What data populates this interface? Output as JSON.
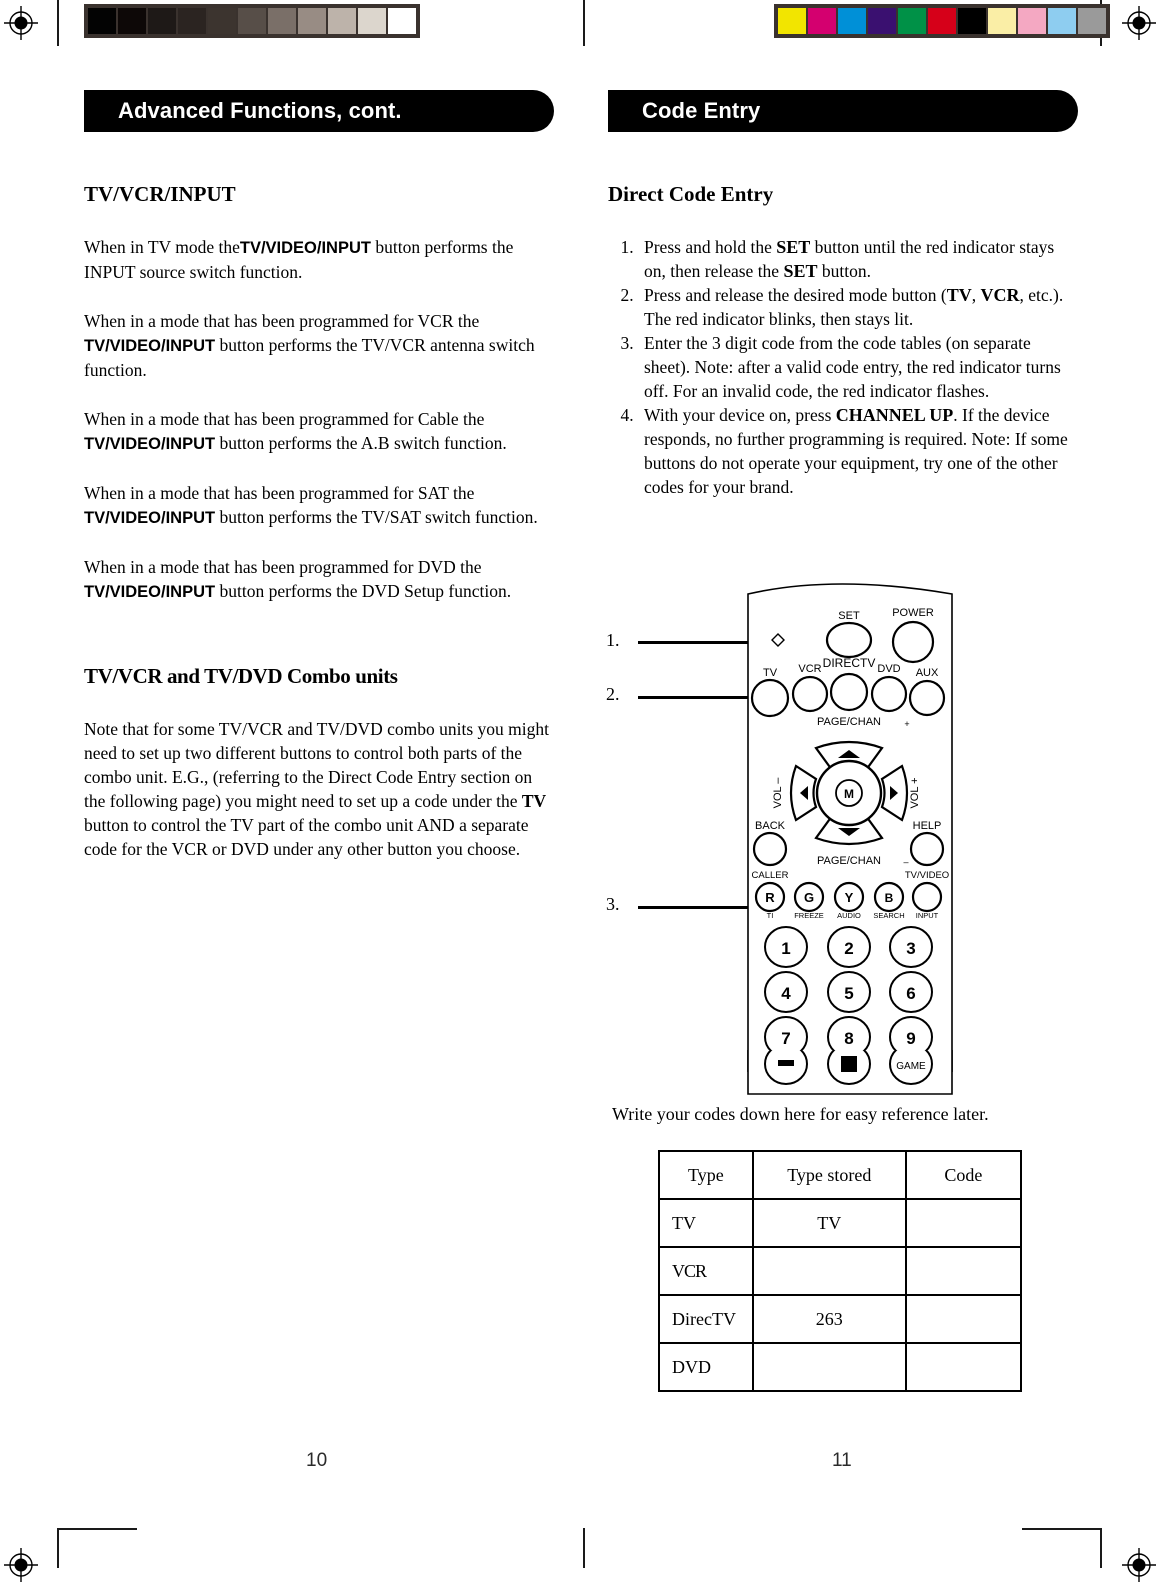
{
  "calibration": {
    "gray_patches": [
      "#030303",
      "#0d0807",
      "#1e1917",
      "#2b2421",
      "#3c342f",
      "#574e48",
      "#7a6f68",
      "#988c84",
      "#bdb3aa",
      "#dcd6cd",
      "#ffffff"
    ],
    "color_patches": [
      "#f2e500",
      "#d4006f",
      "#0090d7",
      "#3a1070",
      "#009147",
      "#d60019",
      "#000000",
      "#faeea6",
      "#f4a8c2",
      "#8ecdf0",
      "#9a9a9a"
    ]
  },
  "left_page": {
    "banner": "Advanced Functions, cont.",
    "heading1": "TV/VCR/INPUT",
    "paragraphs": [
      {
        "pre": "When in TV mode the",
        "bold": "TV/VIDEO/INPUT",
        "post": "button performs the  INPUT source switch function."
      },
      {
        "pre": "When in a mode that has been programmed for VCR the",
        "bold": "TV/VIDEO/INPUT",
        "post": "button performs the TV/VCR antenna switch function."
      },
      {
        "pre": "When in a mode that has been programmed for Cable the",
        "bold": "TV/VIDEO/INPUT",
        "post": "button performs the A.B switch function."
      },
      {
        "pre": "When in a mode that has been programmed for SAT the",
        "bold": "TV/VIDEO/INPUT",
        "post": "button performs the TV/SAT switch function."
      },
      {
        "pre": "When in a mode that has been programmed for DVD the",
        "bold": "TV/VIDEO/INPUT",
        "post": "button performs the DVD Setup function."
      }
    ],
    "heading2": "TV/VCR and TV/DVD Combo units",
    "combo_paragraph_part1": "Note that for some TV/VCR and TV/DVD combo units you might need to set up two different buttons to control both parts of the combo unit. E.G., (referring to the  Direct Code Entry section on the following page) you might need to set up a code under the",
    "combo_paragraph_bold": "TV",
    "combo_paragraph_part2": "button to control the TV part of the combo unit AND a separate code for the VCR or DVD under any other button you choose.",
    "page_number": "10"
  },
  "right_page": {
    "banner": "Code Entry",
    "heading1": "Direct Code Entry",
    "steps": [
      {
        "num": "1.",
        "seg1": "Press and hold the ",
        "sc1": "SET",
        "seg2": " button until the red indicator stays on, then release the ",
        "sc2": "SET",
        "seg3": " button."
      },
      {
        "num": "2.",
        "seg1": "Press and release the desired mode button (",
        "b1": "TV",
        "seg2": ", ",
        "b2": "VCR",
        "seg3": ", etc.). The red indicator blinks, then stays lit."
      },
      {
        "num": "3.",
        "seg1": "Enter the 3 digit code from the code tables (on separate sheet). Note: after a valid code entry, the red indicator turns off.  For an invalid code, the red indicator flashes."
      },
      {
        "num": "4.",
        "seg1": "With your device on, press ",
        "sc1": "CHANNEL UP",
        "seg2": ". If the device responds, no further programming is required. Note: If some buttons do not operate your equipment, try one of the other codes for your brand."
      }
    ],
    "table_caption": "Write your codes down here for easy reference later.",
    "table": {
      "headers": [
        "Type",
        "Type  stored",
        "Code"
      ],
      "rows": [
        {
          "type": "TV",
          "stored": "TV",
          "code": ""
        },
        {
          "type": "VCR",
          "stored": "",
          "code": ""
        },
        {
          "type": "DirecTV",
          "stored": "263",
          "code": ""
        },
        {
          "type": "DVD",
          "stored": "",
          "code": ""
        }
      ]
    },
    "page_number": "11"
  },
  "remote": {
    "callouts": [
      {
        "label": "1.",
        "target": "set-button"
      },
      {
        "label": "2.",
        "target": "tv-mode-button"
      },
      {
        "label": "3.",
        "target": "keypad-one-button"
      }
    ],
    "labels": {
      "set": "SET",
      "power": "POWER",
      "tv": "TV",
      "vcr": "VCR",
      "directv": "DIRECTV",
      "dvd": "DVD",
      "aux": "AUX",
      "page_chan_up": "PAGE/CHAN",
      "page_chan_up_sign": "+",
      "page_chan_down": "PAGE/CHAN",
      "page_chan_down_sign": "–",
      "vol_down": "VOL –",
      "vol_up": "VOL +",
      "menu": "M",
      "back": "BACK",
      "help": "HELP",
      "caller": "CALLER",
      "tv_video": "TV/VIDEO",
      "color_buttons": [
        "R",
        "G",
        "Y",
        "B"
      ],
      "color_sub_labels": [
        "TI",
        "FREEZE",
        "AUDIO",
        "SEARCH",
        "INPUT"
      ],
      "keypad": [
        "1",
        "2",
        "3",
        "4",
        "5",
        "6",
        "7",
        "8",
        "9",
        "–",
        "□",
        "GAME"
      ]
    }
  }
}
